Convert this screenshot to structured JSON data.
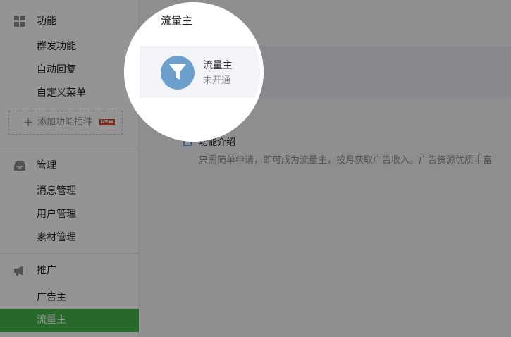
{
  "sidebar": {
    "sections": [
      {
        "label": "功能",
        "icon": "grid-icon",
        "items": [
          {
            "label": "群发功能"
          },
          {
            "label": "自动回复"
          },
          {
            "label": "自定义菜单"
          }
        ],
        "add_plugin": {
          "label": "添加功能插件",
          "badge": "NEW"
        }
      },
      {
        "label": "管理",
        "icon": "inbox-icon",
        "items": [
          {
            "label": "消息管理"
          },
          {
            "label": "用户管理"
          },
          {
            "label": "素材管理"
          }
        ]
      },
      {
        "label": "推广",
        "icon": "megaphone-icon",
        "items": [
          {
            "label": "广告主"
          },
          {
            "label": "流量主",
            "active": true
          }
        ]
      }
    ]
  },
  "main": {
    "title": "流量主",
    "card": {
      "name": "流量主",
      "status": "未开通",
      "icon": "funnel-icon"
    },
    "intro": {
      "title": "功能介绍",
      "description": "只需简单申请，即可成为流量主，按月获取广告收入。广告资源优质丰富"
    }
  },
  "colors": {
    "accent": "#44b549",
    "icon_blue": "#6c9fcb",
    "badge_red": "#d94c31"
  }
}
